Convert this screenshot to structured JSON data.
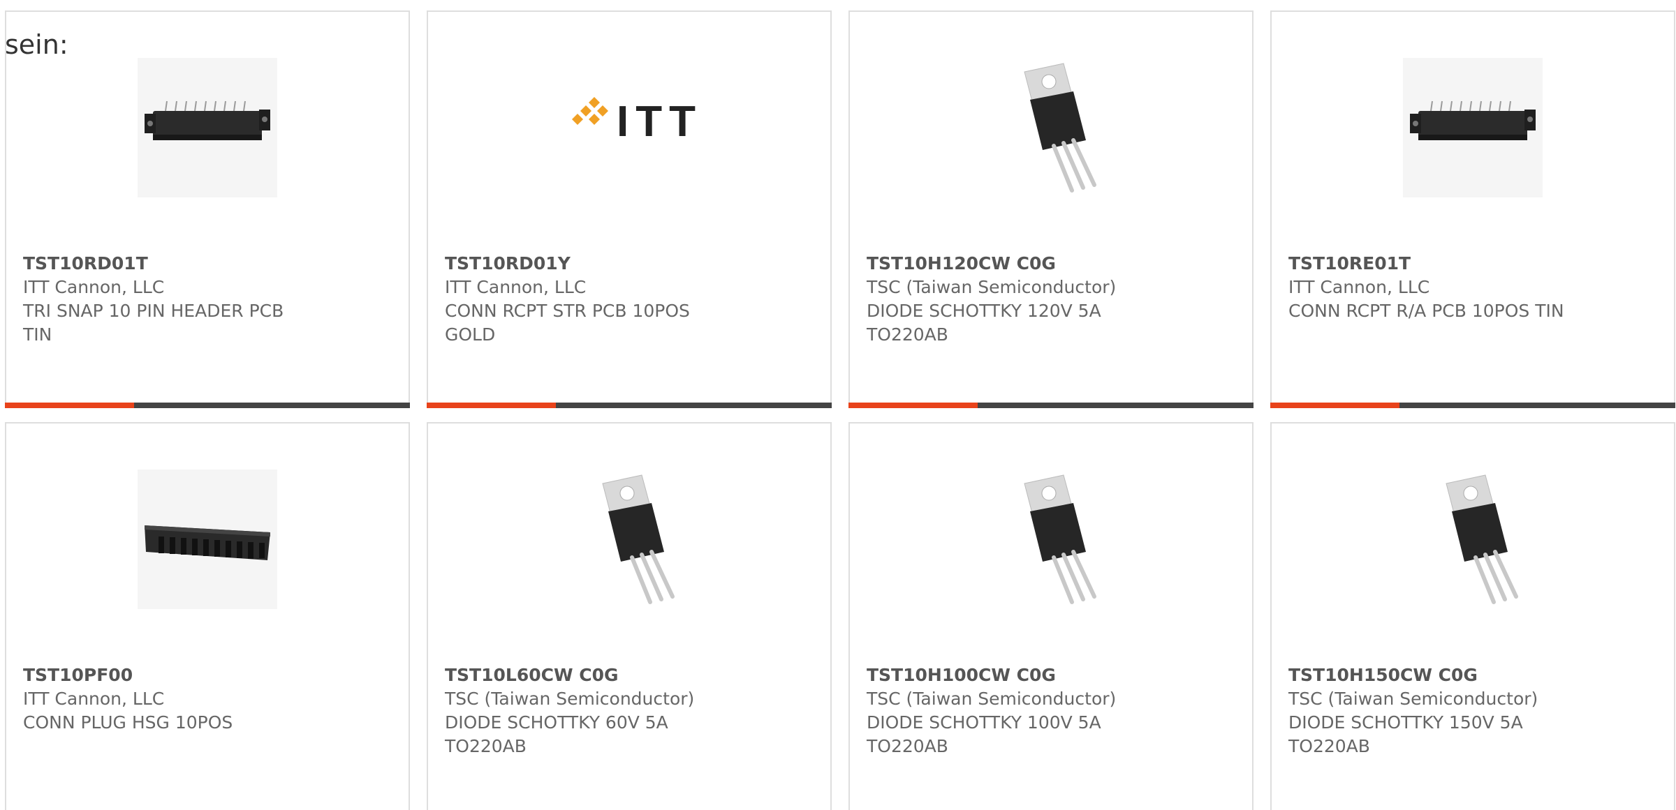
{
  "intro_text": "sein:",
  "colors": {
    "accent": "#e8431b",
    "bar": "#444444",
    "card_border": "#dedede"
  },
  "products": [
    {
      "part_number": "TST10RD01T",
      "manufacturer": "ITT Cannon, LLC",
      "description": "TRI SNAP 10 PIN HEADER PCB TIN",
      "image": "header-connector-image"
    },
    {
      "part_number": "TST10RD01Y",
      "manufacturer": "ITT Cannon, LLC",
      "description": "CONN RCPT STR PCB 10POS GOLD",
      "image": "itt-logo",
      "logo_text": "ITT"
    },
    {
      "part_number": "TST10H120CW C0G",
      "manufacturer": "TSC (Taiwan Semiconductor)",
      "description": "DIODE SCHOTTKY 120V 5A TO220AB",
      "image": "to220-package-image"
    },
    {
      "part_number": "TST10RE01T",
      "manufacturer": "ITT Cannon, LLC",
      "description": "CONN RCPT R/A PCB 10POS TIN",
      "image": "header-connector-image"
    },
    {
      "part_number": "TST10PF00",
      "manufacturer": "ITT Cannon, LLC",
      "description": "CONN PLUG HSG 10POS",
      "image": "plug-housing-image"
    },
    {
      "part_number": "TST10L60CW C0G",
      "manufacturer": "TSC (Taiwan Semiconductor)",
      "description": "DIODE SCHOTTKY 60V 5A TO220AB",
      "image": "to220-package-image"
    },
    {
      "part_number": "TST10H100CW C0G",
      "manufacturer": "TSC (Taiwan Semiconductor)",
      "description": "DIODE SCHOTTKY 100V 5A TO220AB",
      "image": "to220-package-image"
    },
    {
      "part_number": "TST10H150CW C0G",
      "manufacturer": "TSC (Taiwan Semiconductor)",
      "description": "DIODE SCHOTTKY 150V 5A TO220AB",
      "image": "to220-package-image"
    }
  ]
}
